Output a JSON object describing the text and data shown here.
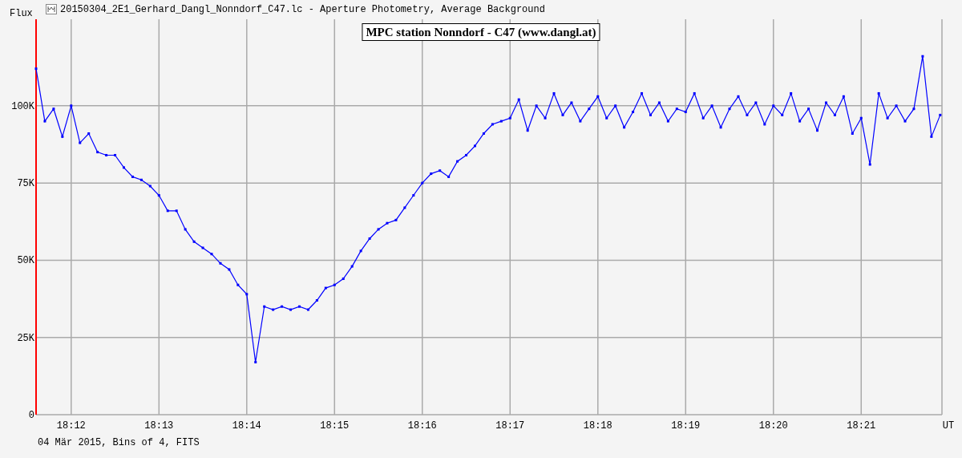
{
  "window": {
    "title": "20150304_2E1_Gerhard_Dangl_Nonndorf_C47.lc - Aperture Photometry, Average Background"
  },
  "chart_data": {
    "type": "line",
    "title": "MPC station Nonndorf - C47 (www.dangl.at)",
    "xlabel": "UT",
    "ylabel": "Flux",
    "categories": [
      null,
      null,
      null,
      null,
      "18:12",
      null,
      null,
      null,
      null,
      null,
      null,
      null,
      null,
      null,
      "18:13",
      null,
      null,
      null,
      null,
      null,
      null,
      null,
      null,
      null,
      "18:14",
      null,
      null,
      null,
      null,
      null,
      null,
      null,
      null,
      null,
      "18:15",
      null,
      null,
      null,
      null,
      null,
      null,
      null,
      null,
      null,
      "18:16",
      null,
      null,
      null,
      null,
      null,
      null,
      null,
      null,
      null,
      "18:17",
      null,
      null,
      null,
      null,
      null,
      null,
      null,
      null,
      null,
      "18:18",
      null,
      null,
      null,
      null,
      null,
      null,
      null,
      null,
      null,
      "18:19",
      null,
      null,
      null,
      null,
      null,
      null,
      null,
      null,
      null,
      "18:20",
      null,
      null,
      null,
      null,
      null,
      null,
      null,
      null,
      null,
      "18:21",
      null,
      null,
      null,
      null,
      null,
      null,
      null,
      null,
      null
    ],
    "grid": true,
    "series": [
      {
        "color": "#0000ff",
        "marker": "square",
        "values": [
          112000,
          95000,
          99000,
          90000,
          100000,
          88000,
          91000,
          85000,
          84000,
          84000,
          80000,
          77000,
          76000,
          74000,
          71000,
          66000,
          66000,
          60000,
          56000,
          54000,
          52000,
          49000,
          47000,
          42000,
          39000,
          17000,
          35000,
          34000,
          35000,
          34000,
          35000,
          34000,
          37000,
          41000,
          42000,
          44000,
          48000,
          53000,
          57000,
          60000,
          62000,
          63000,
          67000,
          71000,
          75000,
          78000,
          79000,
          77000,
          82000,
          84000,
          87000,
          91000,
          94000,
          95000,
          96000,
          102000,
          92000,
          100000,
          96000,
          104000,
          97000,
          101000,
          95000,
          99000,
          103000,
          96000,
          100000,
          93000,
          98000,
          104000,
          97000,
          101000,
          95000,
          99000,
          98000,
          104000,
          96000,
          100000,
          93000,
          99000,
          103000,
          97000,
          101000,
          94000,
          100000,
          97000,
          104000,
          95000,
          99000,
          92000,
          101000,
          97000,
          103000,
          91000,
          96000,
          81000,
          104000,
          96000,
          100000,
          95000,
          99000,
          116000,
          90000,
          97000
        ]
      }
    ],
    "ylim": [
      0,
      128000
    ],
    "yticks": [
      {
        "value": 0,
        "label": "0"
      },
      {
        "value": 25000,
        "label": "25K"
      },
      {
        "value": 50000,
        "label": "50K"
      },
      {
        "value": 75000,
        "label": "75K"
      },
      {
        "value": 100000,
        "label": "100K"
      }
    ]
  },
  "footer": "04 Mär 2015, Bins of 4, FITS"
}
